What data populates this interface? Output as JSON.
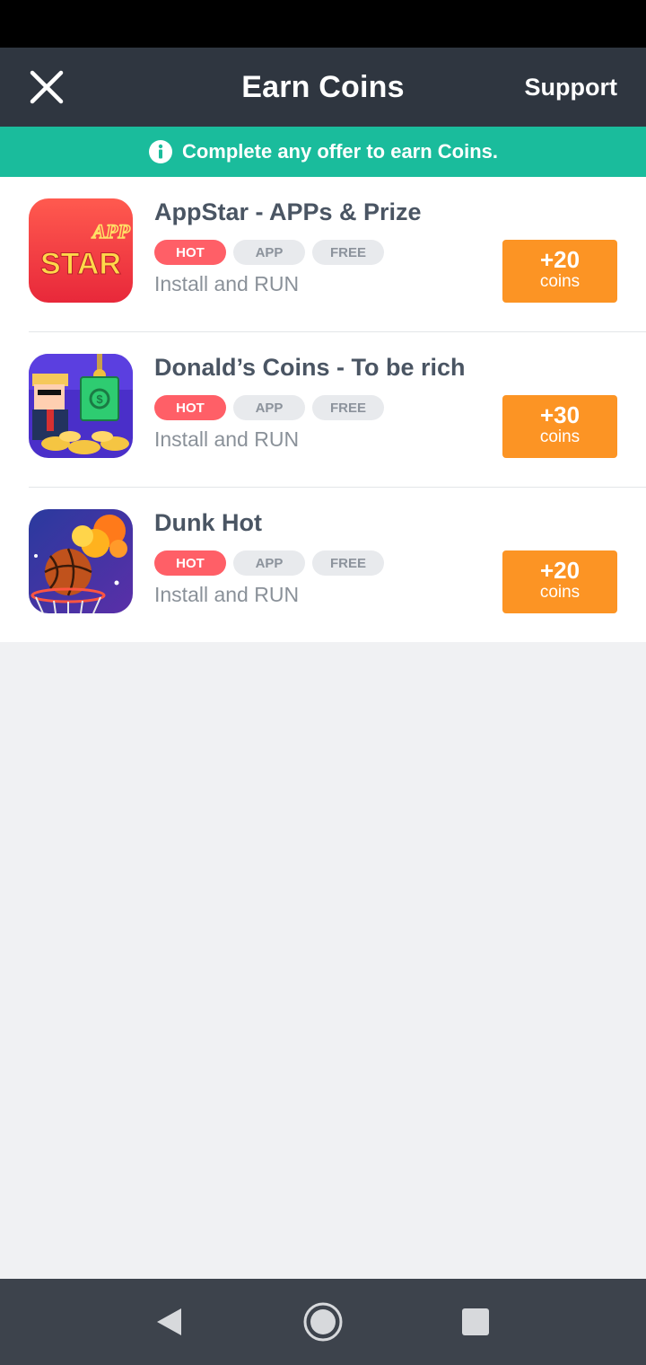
{
  "header": {
    "title": "Earn Coins",
    "support_label": "Support",
    "close_icon": "close-icon"
  },
  "notice": {
    "icon": "info-icon",
    "text": "Complete any offer to earn Coins."
  },
  "offers": [
    {
      "title": "AppStar - APPs & Prize",
      "tags": [
        "HOT",
        "APP",
        "FREE"
      ],
      "description": "Install and RUN",
      "reward_amount": "+20",
      "reward_unit": "coins",
      "icon": "appstar-app-icon",
      "icon_text_small": "APP",
      "icon_text_big": "STAR"
    },
    {
      "title": "Donald’s Coins - To be rich",
      "tags": [
        "HOT",
        "APP",
        "FREE"
      ],
      "description": "Install and RUN",
      "reward_amount": "+30",
      "reward_unit": "coins",
      "icon": "donalds-coins-app-icon"
    },
    {
      "title": "Dunk Hot",
      "tags": [
        "HOT",
        "APP",
        "FREE"
      ],
      "description": "Install and RUN",
      "reward_amount": "+20",
      "reward_unit": "coins",
      "icon": "dunk-hot-app-icon"
    }
  ],
  "colors": {
    "header_bg": "#2f3640",
    "notice_bg": "#1abc9c",
    "hot_tag": "#ff5f67",
    "reward_button": "#fc9424",
    "nav_bar_bg": "#3d434c"
  },
  "nav": {
    "back_icon": "back-triangle-icon",
    "home_icon": "home-circle-icon",
    "recents_icon": "recents-square-icon"
  }
}
